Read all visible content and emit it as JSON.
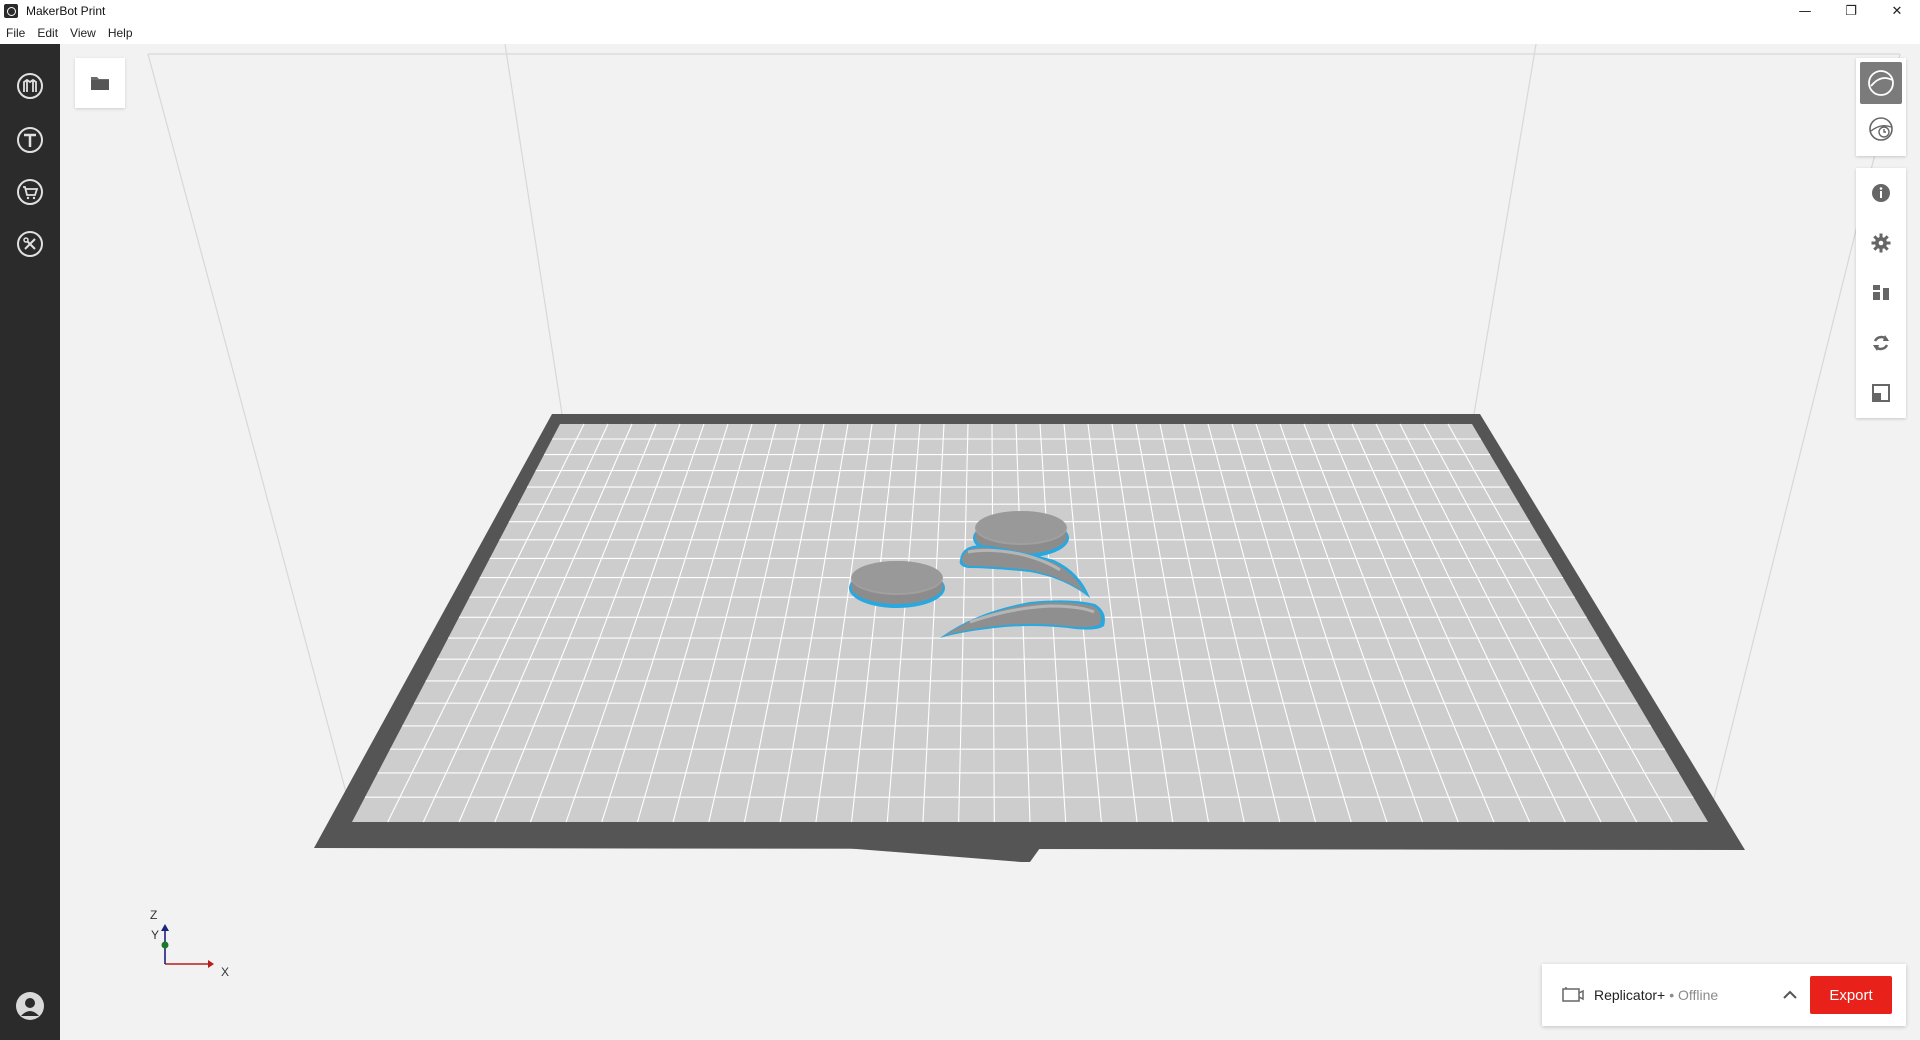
{
  "window": {
    "title": "MakerBot Print",
    "controls": {
      "minimize": "—",
      "maximize": "❐",
      "close": "✕"
    }
  },
  "menu": [
    "File",
    "Edit",
    "View",
    "Help"
  ],
  "sidebar": {
    "items": [
      {
        "name": "makerbot-home-icon"
      },
      {
        "name": "thingiverse-icon"
      },
      {
        "name": "store-icon"
      },
      {
        "name": "settings-tools-icon"
      }
    ],
    "bottom": {
      "name": "user-account-icon"
    }
  },
  "viewport": {
    "file_button_icon": "folder-icon",
    "axes": {
      "z": "Z",
      "y": "Y",
      "x": "X"
    },
    "colors": {
      "background": "#f2f2f2",
      "plate": "#cdcdcd",
      "plate_border": "#555555",
      "model": "#8c8c8c",
      "selection": "#29a8e0"
    }
  },
  "right_panel": {
    "top_group": [
      "view-mode-icon",
      "preview-time-icon"
    ],
    "tools": [
      "info-icon",
      "settings-icon",
      "arrange-icon",
      "rotate-icon",
      "scale-icon"
    ]
  },
  "printbar": {
    "printer": "Replicator+",
    "status": "• Offline",
    "export_label": "Export",
    "accent": "#e8221a"
  }
}
